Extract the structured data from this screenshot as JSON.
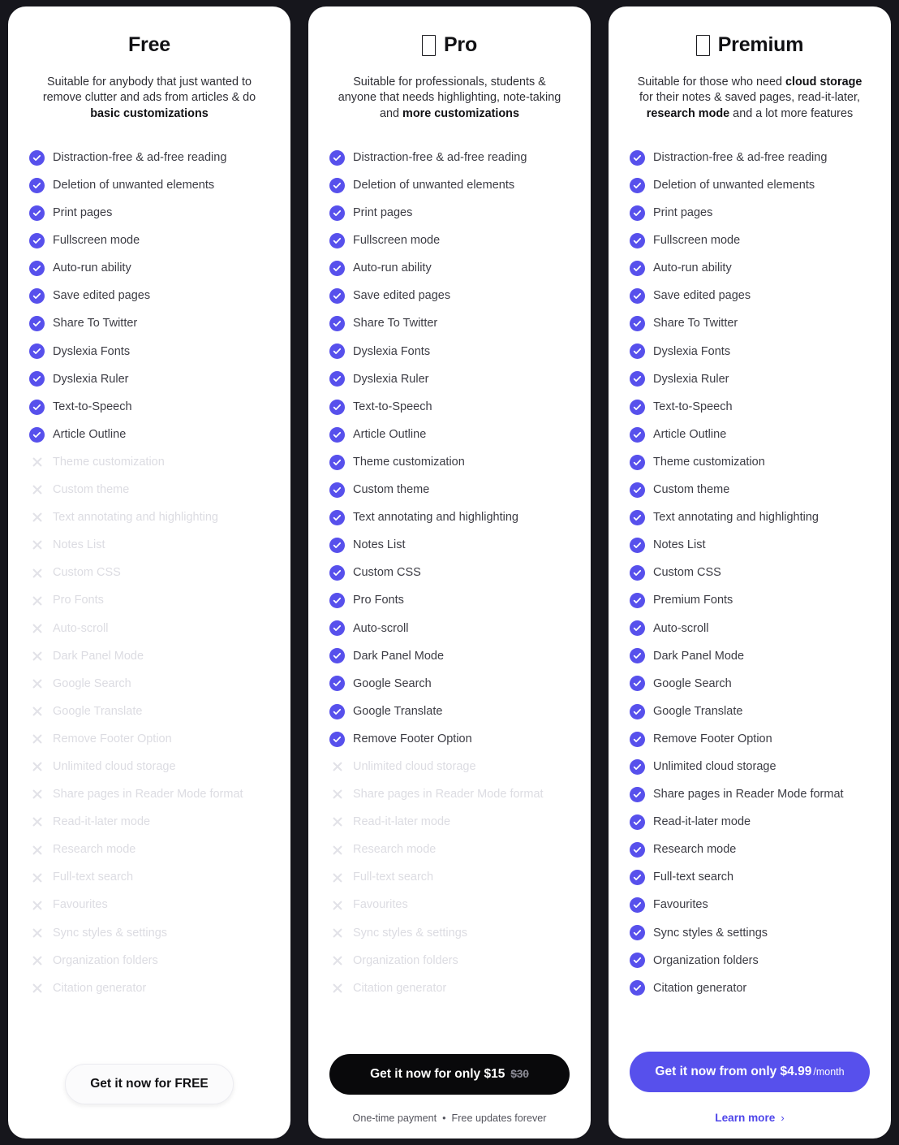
{
  "theme": {
    "page_background": "#16161c",
    "card_background": "#ffffff",
    "accent": "#5750ec",
    "check_icon_color": "#5750ec",
    "cross_icon_color": "#e2e2e8",
    "disabled_text_color": "#dcdce2",
    "dark_button_color": "#09090b"
  },
  "plans": [
    {
      "id": "free",
      "name": "Free",
      "emoji": "",
      "description_parts": [
        {
          "text": "Suitable for anybody that just wanted to remove clutter and ads from articles & do ",
          "bold": false
        },
        {
          "text": "basic customizations",
          "bold": true
        }
      ],
      "features": [
        {
          "label": "Distraction-free & ad-free reading",
          "included": true
        },
        {
          "label": "Deletion of unwanted elements",
          "included": true
        },
        {
          "label": "Print pages",
          "included": true
        },
        {
          "label": "Fullscreen mode",
          "included": true
        },
        {
          "label": "Auto-run ability",
          "included": true
        },
        {
          "label": "Save edited pages",
          "included": true
        },
        {
          "label": "Share To Twitter",
          "included": true
        },
        {
          "label": "Dyslexia Fonts",
          "included": true
        },
        {
          "label": "Dyslexia Ruler",
          "included": true
        },
        {
          "label": "Text-to-Speech",
          "included": true
        },
        {
          "label": "Article Outline",
          "included": true
        },
        {
          "label": "Theme customization",
          "included": false
        },
        {
          "label": "Custom theme",
          "included": false
        },
        {
          "label": "Text annotating and highlighting",
          "included": false
        },
        {
          "label": "Notes List",
          "included": false
        },
        {
          "label": "Custom CSS",
          "included": false
        },
        {
          "label": "Pro Fonts",
          "included": false
        },
        {
          "label": "Auto-scroll",
          "included": false
        },
        {
          "label": "Dark Panel Mode",
          "included": false
        },
        {
          "label": "Google Search",
          "included": false
        },
        {
          "label": "Google Translate",
          "included": false
        },
        {
          "label": "Remove Footer Option",
          "included": false
        },
        {
          "label": "Unlimited cloud storage",
          "included": false
        },
        {
          "label": "Share pages in Reader Mode format",
          "included": false
        },
        {
          "label": "Read-it-later mode",
          "included": false
        },
        {
          "label": "Research mode",
          "included": false
        },
        {
          "label": "Full-text search",
          "included": false
        },
        {
          "label": "Favourites",
          "included": false
        },
        {
          "label": "Sync styles & settings",
          "included": false
        },
        {
          "label": "Organization folders",
          "included": false
        },
        {
          "label": "Citation generator",
          "included": false
        }
      ],
      "cta": {
        "label": "Get it now for FREE",
        "old_price": "",
        "period": "",
        "style": "light"
      },
      "footer_note": "",
      "footer_note_left": "",
      "footer_note_right": "",
      "learn_more": ""
    },
    {
      "id": "pro",
      "name": "Pro",
      "emoji": "missing-glyph-box",
      "description_parts": [
        {
          "text": "Suitable for professionals, students & anyone that needs highlighting, note-taking and ",
          "bold": false
        },
        {
          "text": "more customizations",
          "bold": true
        }
      ],
      "features": [
        {
          "label": "Distraction-free & ad-free reading",
          "included": true
        },
        {
          "label": "Deletion of unwanted elements",
          "included": true
        },
        {
          "label": "Print pages",
          "included": true
        },
        {
          "label": "Fullscreen mode",
          "included": true
        },
        {
          "label": "Auto-run ability",
          "included": true
        },
        {
          "label": "Save edited pages",
          "included": true
        },
        {
          "label": "Share To Twitter",
          "included": true
        },
        {
          "label": "Dyslexia Fonts",
          "included": true
        },
        {
          "label": "Dyslexia Ruler",
          "included": true
        },
        {
          "label": "Text-to-Speech",
          "included": true
        },
        {
          "label": "Article Outline",
          "included": true
        },
        {
          "label": "Theme customization",
          "included": true
        },
        {
          "label": "Custom theme",
          "included": true
        },
        {
          "label": "Text annotating and highlighting",
          "included": true
        },
        {
          "label": "Notes List",
          "included": true
        },
        {
          "label": "Custom CSS",
          "included": true
        },
        {
          "label": "Pro Fonts",
          "included": true
        },
        {
          "label": "Auto-scroll",
          "included": true
        },
        {
          "label": "Dark Panel Mode",
          "included": true
        },
        {
          "label": "Google Search",
          "included": true
        },
        {
          "label": "Google Translate",
          "included": true
        },
        {
          "label": "Remove Footer Option",
          "included": true
        },
        {
          "label": "Unlimited cloud storage",
          "included": false
        },
        {
          "label": "Share pages in Reader Mode format",
          "included": false
        },
        {
          "label": "Read-it-later mode",
          "included": false
        },
        {
          "label": "Research mode",
          "included": false
        },
        {
          "label": "Full-text search",
          "included": false
        },
        {
          "label": "Favourites",
          "included": false
        },
        {
          "label": "Sync styles & settings",
          "included": false
        },
        {
          "label": "Organization folders",
          "included": false
        },
        {
          "label": "Citation generator",
          "included": false
        }
      ],
      "cta": {
        "label": "Get it now for only $15",
        "old_price": "$30",
        "period": "",
        "style": "dark"
      },
      "footer_note_left": "One-time payment",
      "footer_note_dot": "•",
      "footer_note_right": "Free updates forever",
      "learn_more": ""
    },
    {
      "id": "premium",
      "name": "Premium",
      "emoji": "missing-glyph-box",
      "description_parts": [
        {
          "text": "Suitable for those who need ",
          "bold": false
        },
        {
          "text": "cloud storage",
          "bold": true
        },
        {
          "text": " for their notes & saved pages, read-it-later, ",
          "bold": false
        },
        {
          "text": "research mode",
          "bold": true
        },
        {
          "text": " and a lot more features",
          "bold": false
        }
      ],
      "features": [
        {
          "label": "Distraction-free & ad-free reading",
          "included": true
        },
        {
          "label": "Deletion of unwanted elements",
          "included": true
        },
        {
          "label": "Print pages",
          "included": true
        },
        {
          "label": "Fullscreen mode",
          "included": true
        },
        {
          "label": "Auto-run ability",
          "included": true
        },
        {
          "label": "Save edited pages",
          "included": true
        },
        {
          "label": "Share To Twitter",
          "included": true
        },
        {
          "label": "Dyslexia Fonts",
          "included": true
        },
        {
          "label": "Dyslexia Ruler",
          "included": true
        },
        {
          "label": "Text-to-Speech",
          "included": true
        },
        {
          "label": "Article Outline",
          "included": true
        },
        {
          "label": "Theme customization",
          "included": true
        },
        {
          "label": "Custom theme",
          "included": true
        },
        {
          "label": "Text annotating and highlighting",
          "included": true
        },
        {
          "label": "Notes List",
          "included": true
        },
        {
          "label": "Custom CSS",
          "included": true
        },
        {
          "label": "Premium Fonts",
          "included": true
        },
        {
          "label": "Auto-scroll",
          "included": true
        },
        {
          "label": "Dark Panel Mode",
          "included": true
        },
        {
          "label": "Google Search",
          "included": true
        },
        {
          "label": "Google Translate",
          "included": true
        },
        {
          "label": "Remove Footer Option",
          "included": true
        },
        {
          "label": "Unlimited cloud storage",
          "included": true
        },
        {
          "label": "Share pages in Reader Mode format",
          "included": true
        },
        {
          "label": "Read-it-later mode",
          "included": true
        },
        {
          "label": "Research mode",
          "included": true
        },
        {
          "label": "Full-text search",
          "included": true
        },
        {
          "label": "Favourites",
          "included": true
        },
        {
          "label": "Sync styles & settings",
          "included": true
        },
        {
          "label": "Organization folders",
          "included": true
        },
        {
          "label": "Citation generator",
          "included": true
        }
      ],
      "cta": {
        "label": "Get it now from only $4.99",
        "old_price": "",
        "period": "/month",
        "style": "accent"
      },
      "footer_note_left": "",
      "footer_note_right": "",
      "learn_more": "Learn more",
      "learn_more_chevron": "›"
    }
  ]
}
